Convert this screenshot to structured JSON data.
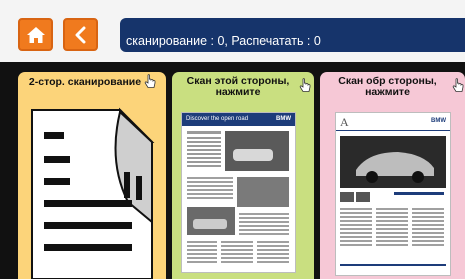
{
  "toolbar": {
    "home_icon": "home-icon",
    "back_icon": "chevron-left-icon",
    "accent": "#f07a1e"
  },
  "status": {
    "text": "сканирование : 0, Распечатать : 0",
    "background": "#16346b"
  },
  "cards": [
    {
      "title": "2-стор. сканирование",
      "color": "#fcd47a",
      "icon": "duplex-document-icon"
    },
    {
      "title": "Скан этой стороны, нажмите",
      "color": "#c9df80",
      "thumbnail_header": "Discover the open road",
      "thumbnail_logo": "BMW"
    },
    {
      "title": "Скан обр стороны, нажмите",
      "color": "#f6c8d6",
      "thumbnail_logo": "BMW"
    }
  ]
}
